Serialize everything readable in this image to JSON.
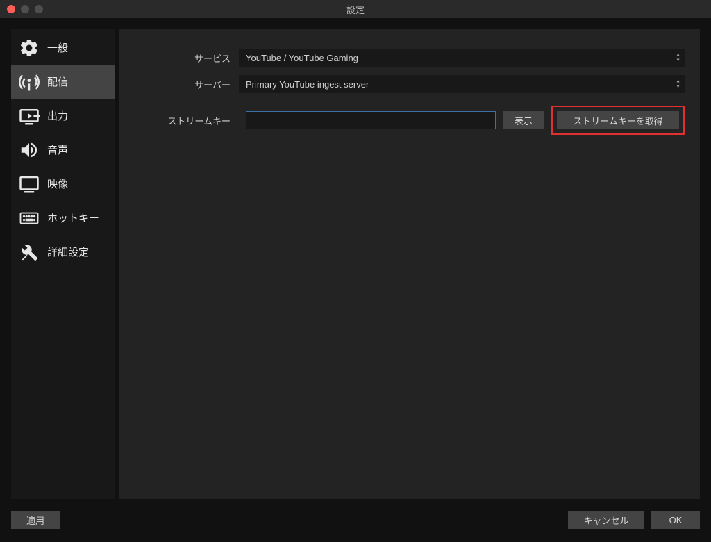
{
  "window": {
    "title": "設定"
  },
  "sidebar": {
    "items": [
      {
        "label": "一般"
      },
      {
        "label": "配信"
      },
      {
        "label": "出力"
      },
      {
        "label": "音声"
      },
      {
        "label": "映像"
      },
      {
        "label": "ホットキー"
      },
      {
        "label": "詳細設定"
      }
    ]
  },
  "form": {
    "service_label": "サービス",
    "service_value": "YouTube / YouTube Gaming",
    "server_label": "サーバー",
    "server_value": "Primary YouTube ingest server",
    "streamkey_label": "ストリームキー",
    "streamkey_value": "",
    "show_button": "表示",
    "getkey_button": "ストリームキーを取得"
  },
  "footer": {
    "apply": "適用",
    "cancel": "キャンセル",
    "ok": "OK"
  }
}
